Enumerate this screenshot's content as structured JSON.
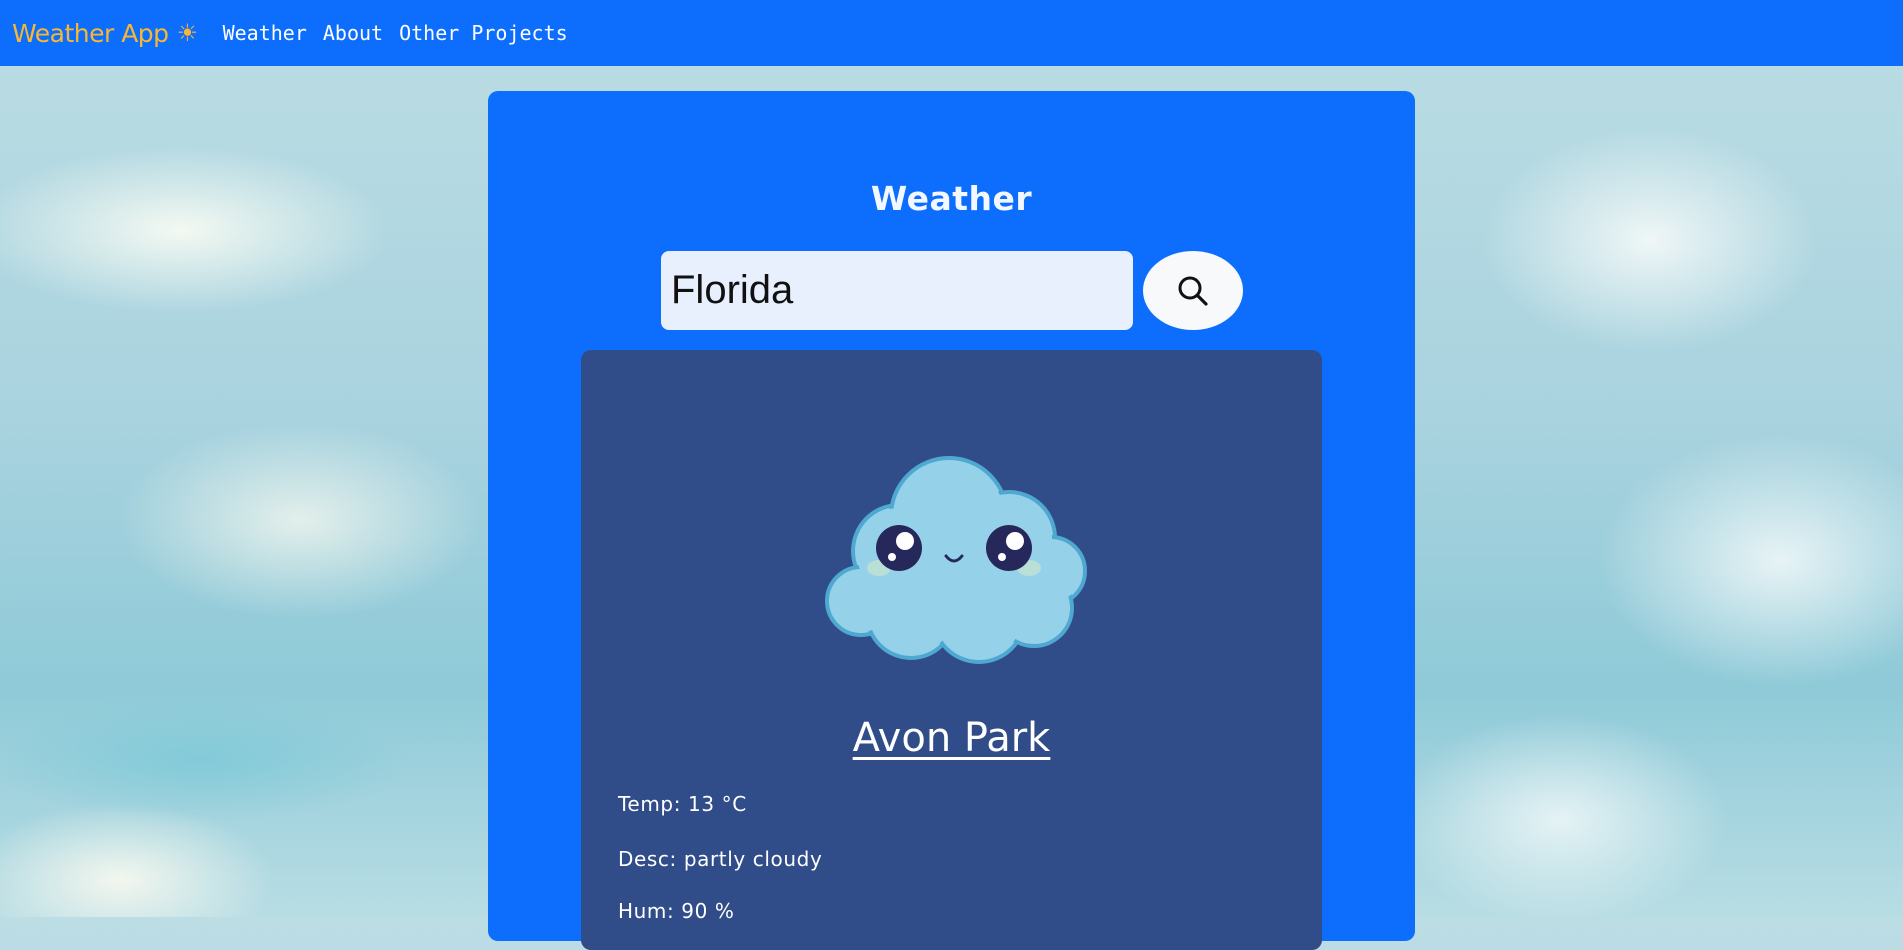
{
  "navbar": {
    "brand": "Weather App",
    "brand_icon": "sun-icon",
    "links": [
      "Weather",
      "About",
      "Other Projects"
    ]
  },
  "main": {
    "title": "Weather",
    "search": {
      "value": "Florida",
      "button_icon": "search-icon"
    },
    "result": {
      "image": "cloud-mascot",
      "city": "Avon Park",
      "temp": "Temp: 13 °C",
      "desc": "Desc: partly cloudy",
      "hum": "Hum: 90 %"
    }
  },
  "colors": {
    "primary": "#0d6efd",
    "brand": "#f7b733",
    "card": "#304c89",
    "input_bg": "#e8f0fe"
  }
}
